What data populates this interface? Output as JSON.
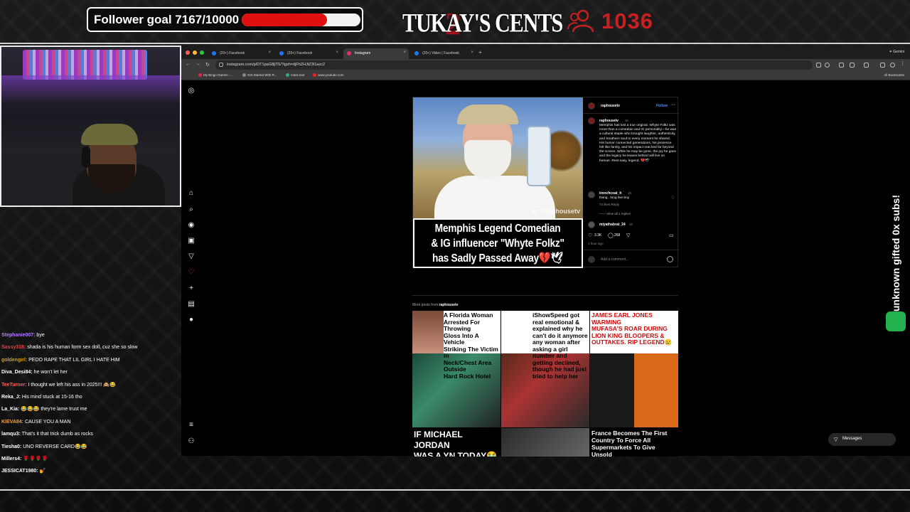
{
  "overlay": {
    "follower_goal_label": "Follower goal 7167/10000",
    "follower_goal_progress": 0.7167,
    "brand": "TUKAY'S CENTS",
    "brand_mark": "2",
    "viewer_count": "1036",
    "side_banner": "unknown gifted 0x subs!"
  },
  "chat": [
    {
      "user": "Stephanie007:",
      "msg": "bye",
      "color": "#b57cff"
    },
    {
      "user": "Sassy318:",
      "msg": "shada is his human form sex doll, cuz she so slow",
      "color": "#ff3b3b"
    },
    {
      "user": "goldengirl:",
      "msg": "PEDO RAPE THAT LIL GIRL I HATE HIM",
      "color": "#d4a017"
    },
    {
      "user": "Diva_Desi84:",
      "msg": "he won't let her",
      "color": "#ffffff"
    },
    {
      "user": "TeeTurner:",
      "msg": "I thought we left his ass in 2025!!! 🙈😂",
      "color": "#ff5e5e"
    },
    {
      "user": "Reka_J:",
      "msg": "His mind stuck at 15-16 tho",
      "color": "#ffffff"
    },
    {
      "user": "La_Kia:",
      "msg": "😂😂😂 they're lame trust me",
      "color": "#ffffff"
    },
    {
      "user": "KIEVA84:",
      "msg": "CAUSE YOU A MAN",
      "color": "#ff9d2e"
    },
    {
      "user": "lamqu3:",
      "msg": "That's it that trick dumb as rocks",
      "color": "#ffffff"
    },
    {
      "user": "Tiesha0:",
      "msg": "UNO REVERSE CARD😂😂",
      "color": "#ffffff"
    },
    {
      "user": "Millers4:",
      "msg": "🌹🌹🌹🌹",
      "color": "#ffffff"
    },
    {
      "user": "JESSICAT1980:",
      "msg": "💅",
      "color": "#ffffff"
    }
  ],
  "browser": {
    "tabs": [
      {
        "label": "(20+) Facebook",
        "active": false
      },
      {
        "label": "(20+) Facebook",
        "active": false
      },
      {
        "label": "Instagram",
        "active": true
      },
      {
        "label": "(20+) Video | Facebook",
        "active": false
      }
    ],
    "gemini_label": "Gemini",
    "url": "instagram.com/p/DT1paG8jIT5/?igsh=djFhZHJtZ3I1azc2",
    "bookmarks": [
      "My Bingo Games -...",
      "Get Started With R...",
      "mass text",
      "www.youtube.com"
    ],
    "all_bookmarks": "All Bookmarks"
  },
  "post": {
    "author": "raphousetv",
    "follow": "Follow",
    "watermark": "ig:@raphousetv",
    "headline": "Memphis Legend Comedian\n& IG influencer \"Whyte Folkz\"\nhas Sadly Passed Away💔🕊",
    "caption_time": "1h",
    "caption": "Memphis has lost a true original. Whyte Folkz was more than a comedian and IG personality—he was a cultural staple who brought laughter, authenticity, and Southern soul to every moment he shared. His humor connected generations, his presence felt like family, and his impact reached far beyond the screen. While he may be gone, the joy he gave and the legacy he leaves behind will live on forever. Rest easy, legend. 💔🕊",
    "comment_user": "trenchcoat_h",
    "comment_time": "1h",
    "comment_text": "Dang.. long live boy",
    "comment_meta": "74 likes   Reply",
    "view_replies": "View all 1 replies",
    "reply_user": "miyathabrat_24",
    "reply_time": "1h",
    "likes": "3.3K",
    "comments": "268",
    "date": "1 hour ago",
    "add_comment": "Add a comment..."
  },
  "more_posts": {
    "label": "More posts from",
    "author": "raphousetv",
    "tiles": [
      {
        "head": "A Florida Woman\nArrested For Throwing\nGloss Into A Vehicle\nStriking The Victim in\nNeck/Chest Area Outside\nHard Rock Hotel",
        "red": false
      },
      {
        "head": "iShowSpeed got real emotional &\nexplained why he can't do it anymore\nany woman after asking a girl\nnumber and getting declined,\nthough he had just tried to help her",
        "red": false
      },
      {
        "head": "JAMES EARL JONES WARMING\nMUFASA'S ROAR DURING\nLION KING BLOOPERS &\nOUTTAKES. RIP LEGEND😢",
        "red": true
      },
      {
        "head": "IF MICHAEL JORDAN\nWAS A YN TODAY😭",
        "red": false
      },
      {
        "head": "",
        "red": false
      },
      {
        "head": "France Becomes The First\nCountry To Force All\nSupermarkets To Give Unsold",
        "red": false
      }
    ]
  },
  "messages_label": "Messages",
  "colors": {
    "accent_red": "#e01010",
    "ig_blue": "#4a8df8"
  }
}
